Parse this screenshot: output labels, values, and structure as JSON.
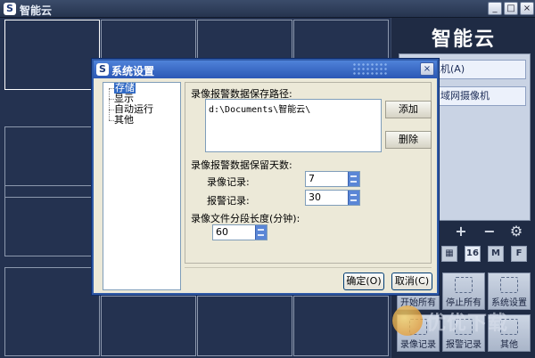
{
  "window": {
    "title": "智能云",
    "icon": "app-logo-icon",
    "controls": [
      "_",
      "□",
      "×"
    ]
  },
  "right_panel": {
    "brand": "智能云",
    "devices": [
      "增摄像机(A)",
      "新增局域网摄像机"
    ],
    "tools": {
      "add": "+",
      "remove": "−",
      "settings_glyph": "⚙"
    },
    "view_buttons": [
      "▦",
      "16",
      "M",
      "F"
    ],
    "actions": [
      "开始所有",
      "停止所有",
      "系统设置",
      "录像记录",
      "报警记录",
      "其他"
    ],
    "watermark": "优优下载"
  },
  "dialog": {
    "title": "系统设置",
    "close": "×",
    "tree": [
      "存储",
      "显示",
      "自动运行",
      "其他"
    ],
    "path_label": "录像报警数据保存路径:",
    "paths": [
      "d:\\Documents\\智能云\\"
    ],
    "add_button": "添加",
    "delete_button": "删除",
    "retention_label": "录像报警数据保留天数:",
    "record_label": "录像记录:",
    "record_days": "7",
    "alarm_label": "报警记录:",
    "alarm_days": "30",
    "segment_label": "录像文件分段长度(分钟):",
    "segment_minutes": "60",
    "ok_button": "确定(O)",
    "cancel_button": "取消(C)"
  }
}
